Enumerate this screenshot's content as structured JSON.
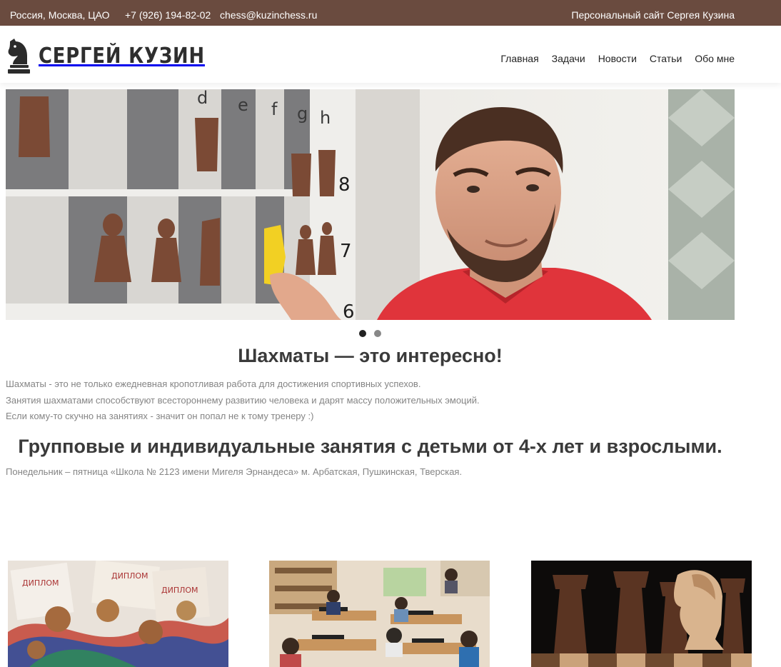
{
  "topbar": {
    "location": "Россия, Москва, ЦАО",
    "phone": "+7 (926) 194-82-02",
    "email": "chess@kuzinchess.ru",
    "personal_site": "Персональный сайт Сергея Кузина"
  },
  "header": {
    "logo_text": "СЕРГЕЙ КУЗИН",
    "logo_icon": "chess-knight-icon",
    "nav": [
      "Главная",
      "Задачи",
      "Новости",
      "Статьи",
      "Обо мне"
    ]
  },
  "slider": {
    "slide_count": 2,
    "active_index": 0
  },
  "main": {
    "title": "Шахматы — это интересно!",
    "intro_lines": [
      "Шахматы - это не только ежедневная кропотливая работа для достижения спортивных успехов.",
      "Занятия шахматами способствуют всестороннему развитию человека и дарят массу положительных эмоций.",
      "Если кому-то скучно на занятиях - значит он попал не к тому тренеру :)"
    ],
    "subtitle": "Групповые и индивидуальные занятия с детьми от 4-х лет и взрослыми.",
    "schedule": "Понедельник – пятница «Школа № 2123 имени Мигеля Эрнандеса» м. Арбатская, Пушкинская, Тверская."
  },
  "hero_board": {
    "files": [
      "d",
      "e",
      "f",
      "g",
      "h"
    ],
    "ranks": [
      "8",
      "7",
      "6"
    ]
  },
  "gallery": {
    "diploma_word": "ДИПЛОМ"
  },
  "colors": {
    "topbar_bg": "#6a4b3f",
    "text_dark": "#3a3a3a",
    "text_muted": "#858585",
    "shirt_red": "#e0343b"
  }
}
